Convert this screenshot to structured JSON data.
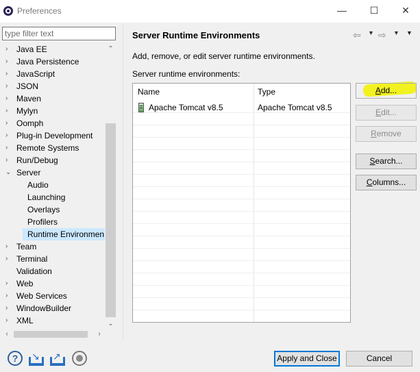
{
  "window": {
    "title": "Preferences",
    "minimize_glyph": "—",
    "maximize_glyph": "☐",
    "close_glyph": "✕"
  },
  "sidebar": {
    "filter_placeholder": "type filter text",
    "items": [
      {
        "label": "Java EE",
        "expander": "›",
        "indent": 0
      },
      {
        "label": "Java Persistence",
        "expander": "›",
        "indent": 0
      },
      {
        "label": "JavaScript",
        "expander": "›",
        "indent": 0
      },
      {
        "label": "JSON",
        "expander": "›",
        "indent": 0
      },
      {
        "label": "Maven",
        "expander": "›",
        "indent": 0
      },
      {
        "label": "Mylyn",
        "expander": "›",
        "indent": 0
      },
      {
        "label": "Oomph",
        "expander": "›",
        "indent": 0
      },
      {
        "label": "Plug-in Development",
        "expander": "›",
        "indent": 0
      },
      {
        "label": "Remote Systems",
        "expander": "›",
        "indent": 0
      },
      {
        "label": "Run/Debug",
        "expander": "›",
        "indent": 0
      },
      {
        "label": "Server",
        "expander": "⌄",
        "indent": 0
      },
      {
        "label": "Audio",
        "expander": "",
        "indent": 1
      },
      {
        "label": "Launching",
        "expander": "",
        "indent": 1
      },
      {
        "label": "Overlays",
        "expander": "",
        "indent": 1
      },
      {
        "label": "Profilers",
        "expander": "",
        "indent": 1
      },
      {
        "label": "Runtime Environmen",
        "expander": "",
        "indent": 1,
        "selected": true
      },
      {
        "label": "Team",
        "expander": "›",
        "indent": 0
      },
      {
        "label": "Terminal",
        "expander": "›",
        "indent": 0
      },
      {
        "label": "Validation",
        "expander": "",
        "indent": 0
      },
      {
        "label": "Web",
        "expander": "›",
        "indent": 0
      },
      {
        "label": "Web Services",
        "expander": "›",
        "indent": 0
      },
      {
        "label": "WindowBuilder",
        "expander": "›",
        "indent": 0
      },
      {
        "label": "XML",
        "expander": "›",
        "indent": 0
      }
    ]
  },
  "page": {
    "title": "Server Runtime Environments",
    "description": "Add, remove, or edit server runtime environments.",
    "list_label": "Server runtime environments:",
    "nav_back": "⇦",
    "nav_forward": "⇨",
    "nav_dropdown": "▼"
  },
  "table": {
    "columns": [
      "Name",
      "Type"
    ],
    "rows": [
      {
        "name": "Apache Tomcat v8.5",
        "type": "Apache Tomcat v8.5"
      }
    ]
  },
  "buttons": {
    "add": {
      "mnemonic": "A",
      "rest": "dd..."
    },
    "edit": {
      "mnemonic": "E",
      "rest": "dit..."
    },
    "remove": {
      "mnemonic": "R",
      "rest": "emove"
    },
    "search": {
      "mnemonic": "S",
      "rest": "earch..."
    },
    "columns": {
      "mnemonic": "C",
      "rest": "olumns..."
    },
    "apply_close": "Apply and Close",
    "cancel": "Cancel"
  },
  "colors": {
    "selection": "#cce8ff",
    "highlight": "#f2f20a",
    "default_button_border": "#0078d7"
  },
  "icons": [
    "help-icon",
    "import-icon",
    "export-icon",
    "record-icon",
    "tomcat-server-icon"
  ]
}
